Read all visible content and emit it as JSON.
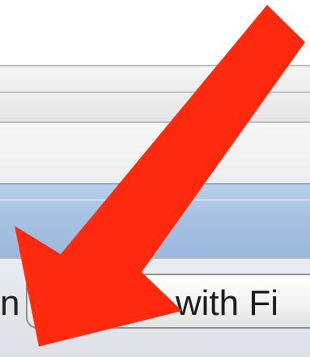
{
  "toolbar": {
    "left_label": "n",
    "button_label": "with Fi"
  },
  "colors": {
    "arrow": "#ff2a0d",
    "titlebar": "#a7c1e2"
  },
  "icons": {
    "overlay_arrow": "arrow-down-left-icon"
  }
}
